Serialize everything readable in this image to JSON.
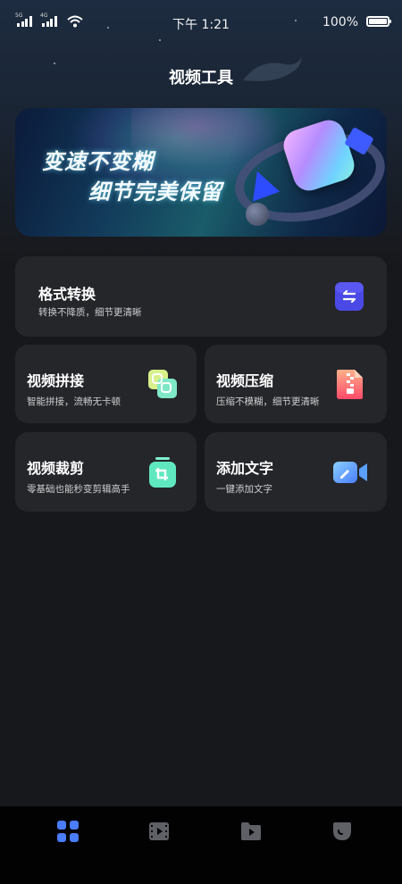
{
  "status_bar": {
    "network_1": "5G",
    "network_2": "4G",
    "time": "下午 1:21",
    "battery_percent": "100%",
    "wifi_icon": "wifi-icon",
    "battery_icon": "battery-icon"
  },
  "header": {
    "title": "视频工具"
  },
  "banner": {
    "line1": "变速不变糊",
    "line2": "细节完美保留"
  },
  "tools": {
    "format": {
      "title": "格式转换",
      "subtitle": "转换不降质，细节更清晰",
      "icon": "convert-icon",
      "color": "#4a49e6"
    },
    "merge": {
      "title": "视频拼接",
      "subtitle": "智能拼接，流畅无卡顿",
      "icon": "merge-icon",
      "color": "#7fe8c6"
    },
    "compress": {
      "title": "视频压缩",
      "subtitle": "压缩不模糊，细节更清晰",
      "icon": "compress-icon",
      "color": "#ff5b6e"
    },
    "crop": {
      "title": "视频裁剪",
      "subtitle": "零基础也能秒变剪辑高手",
      "icon": "crop-icon",
      "color": "#5fe8c0"
    },
    "text": {
      "title": "添加文字",
      "subtitle": "一键添加文字",
      "icon": "add-text-video-icon",
      "color": "#5a9bff"
    }
  },
  "bottom_nav": {
    "items": [
      {
        "icon": "tools-grid-icon",
        "active": true
      },
      {
        "icon": "film-icon",
        "active": false
      },
      {
        "icon": "video-folder-icon",
        "active": false
      },
      {
        "icon": "profile-icon",
        "active": false
      }
    ],
    "active_color": "#4a7dff",
    "inactive_color": "#5f6066"
  }
}
